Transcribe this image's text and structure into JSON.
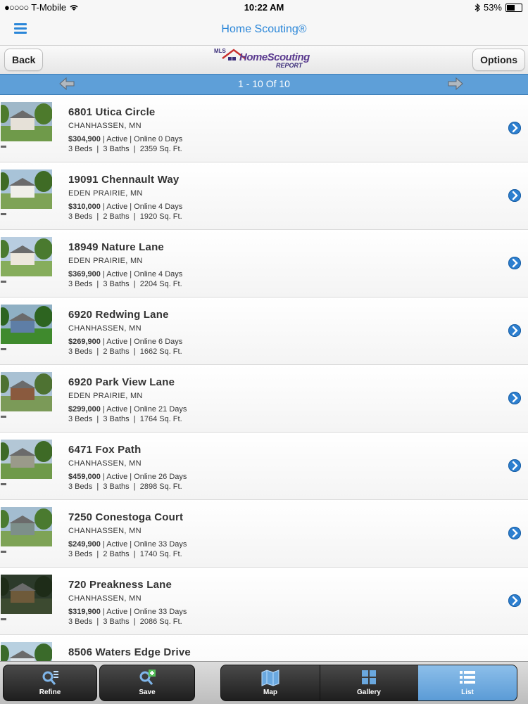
{
  "status": {
    "carrier": "T-Mobile",
    "time": "10:22 AM",
    "battery": "53%",
    "battery_level": 0.53
  },
  "nav": {
    "title": "Home Scouting®"
  },
  "header": {
    "back_label": "Back",
    "options_label": "Options",
    "logo": {
      "top": "MLS",
      "main": "HomeScouting",
      "sub": "REPORT"
    }
  },
  "pager": {
    "text": "1 - 10 Of 10"
  },
  "listings": [
    {
      "address": "6801 Utica Circle",
      "city": "CHANHASSEN, MN",
      "price": "$304,900",
      "status": " | Active | Online 0 Days",
      "details": "3 Beds  |  3 Baths  |  2359 Sq. Ft."
    },
    {
      "address": "19091 Chennault Way",
      "city": "EDEN PRAIRIE, MN",
      "price": "$310,000",
      "status": " | Active | Online 4 Days",
      "details": "3 Beds  |  2 Baths  |  1920 Sq. Ft."
    },
    {
      "address": "18949 Nature Lane",
      "city": "EDEN PRAIRIE, MN",
      "price": "$369,900",
      "status": " | Active | Online 4 Days",
      "details": "3 Beds  |  3 Baths  |  2204 Sq. Ft."
    },
    {
      "address": "6920 Redwing Lane",
      "city": "CHANHASSEN, MN",
      "price": "$269,900",
      "status": " | Active | Online 6 Days",
      "details": "3 Beds  |  2 Baths  |  1662 Sq. Ft."
    },
    {
      "address": "6920 Park View Lane",
      "city": "EDEN PRAIRIE, MN",
      "price": "$299,000",
      "status": " | Active | Online 21 Days",
      "details": "3 Beds  |  3 Baths  |  1764 Sq. Ft."
    },
    {
      "address": "6471 Fox Path",
      "city": "CHANHASSEN, MN",
      "price": "$459,000",
      "status": " | Active | Online 26 Days",
      "details": "3 Beds  |  3 Baths  |  2898 Sq. Ft."
    },
    {
      "address": "7250 Conestoga Court",
      "city": "CHANHASSEN, MN",
      "price": "$249,900",
      "status": " | Active | Online 33 Days",
      "details": "3 Beds  |  2 Baths  |  1740 Sq. Ft."
    },
    {
      "address": "720 Preakness Lane",
      "city": "CHANHASSEN, MN",
      "price": "$319,900",
      "status": " | Active | Online 33 Days",
      "details": "3 Beds  |  3 Baths  |  2086 Sq. Ft."
    },
    {
      "address": "8506 Waters Edge Drive",
      "city": "",
      "price": "",
      "status": "",
      "details": ""
    }
  ],
  "tabs": {
    "refine": "Refine",
    "save": "Save",
    "map": "Map",
    "gallery": "Gallery",
    "list": "List"
  },
  "colors": {
    "accent": "#2a86d8",
    "pager_bg": "#5e9fd8",
    "active_tab": "#6aa8df"
  },
  "icons": {
    "menu": "hamburger-icon",
    "bluetooth": "bluetooth-icon",
    "wifi": "wifi-icon",
    "prev": "arrow-left-icon",
    "next": "arrow-right-icon",
    "row": "chevron-right-icon",
    "refine": "search-list-icon",
    "save": "search-plus-icon",
    "map": "map-icon",
    "gallery": "grid-icon",
    "list": "list-icon"
  }
}
